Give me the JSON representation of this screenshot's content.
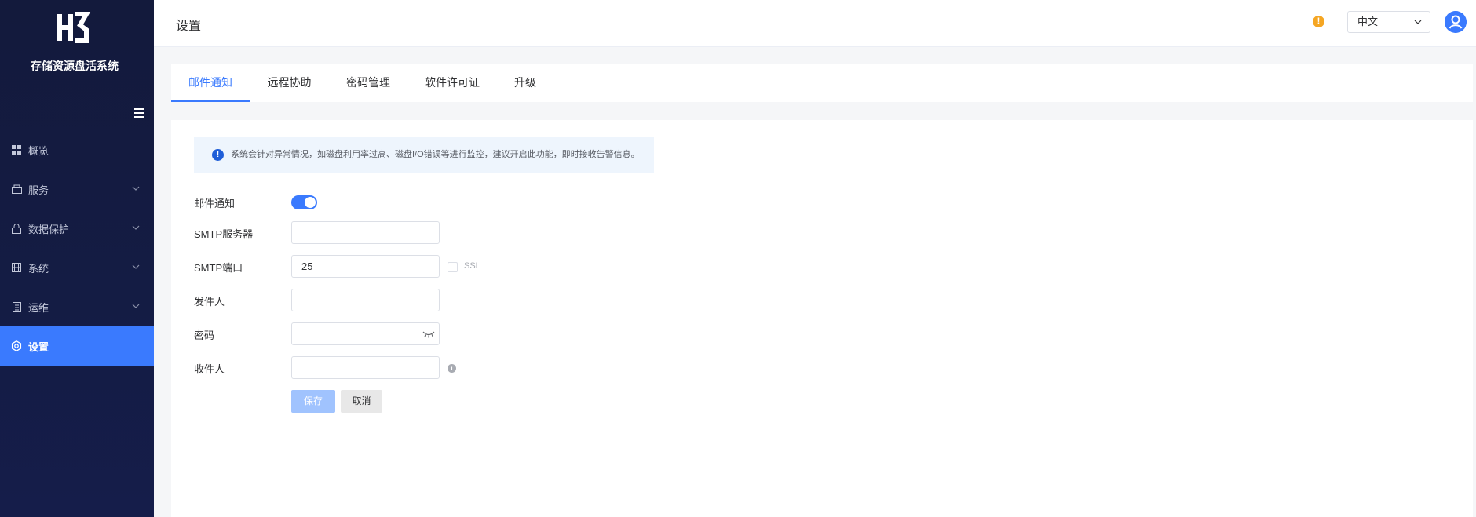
{
  "app": {
    "name": "存储资源盘活系统"
  },
  "sidebar": {
    "items": [
      {
        "label": "概览",
        "icon": "grid-icon",
        "expandable": false
      },
      {
        "label": "服务",
        "icon": "box-icon",
        "expandable": true
      },
      {
        "label": "数据保护",
        "icon": "lock-icon",
        "expandable": true
      },
      {
        "label": "系统",
        "icon": "film-icon",
        "expandable": true
      },
      {
        "label": "运维",
        "icon": "document-icon",
        "expandable": true
      },
      {
        "label": "设置",
        "icon": "gear-icon",
        "expandable": false,
        "active": true
      }
    ]
  },
  "header": {
    "title": "设置",
    "language": "中文"
  },
  "tabs": [
    {
      "label": "邮件通知",
      "active": true
    },
    {
      "label": "远程协助"
    },
    {
      "label": "密码管理"
    },
    {
      "label": "软件许可证"
    },
    {
      "label": "升级"
    }
  ],
  "notice": {
    "text": "系统会针对异常情况，如磁盘利用率过高、磁盘I/O错误等进行监控，建议开启此功能，即时接收告警信息。"
  },
  "form": {
    "email_notify_label": "邮件通知",
    "email_notify_enabled": true,
    "smtp_server_label": "SMTP服务器",
    "smtp_server_value": "",
    "smtp_port_label": "SMTP端口",
    "smtp_port_value": "25",
    "ssl_label": "SSL",
    "ssl_checked": false,
    "sender_label": "发件人",
    "sender_value": "",
    "password_label": "密码",
    "password_value": "",
    "recipient_label": "收件人",
    "recipient_value": "",
    "save_label": "保存",
    "cancel_label": "取消"
  },
  "colors": {
    "accent": "#3a7afe",
    "sidebar_bg": "#131a3c",
    "warning": "#f5a623",
    "notice_bg": "#eef5fd"
  }
}
